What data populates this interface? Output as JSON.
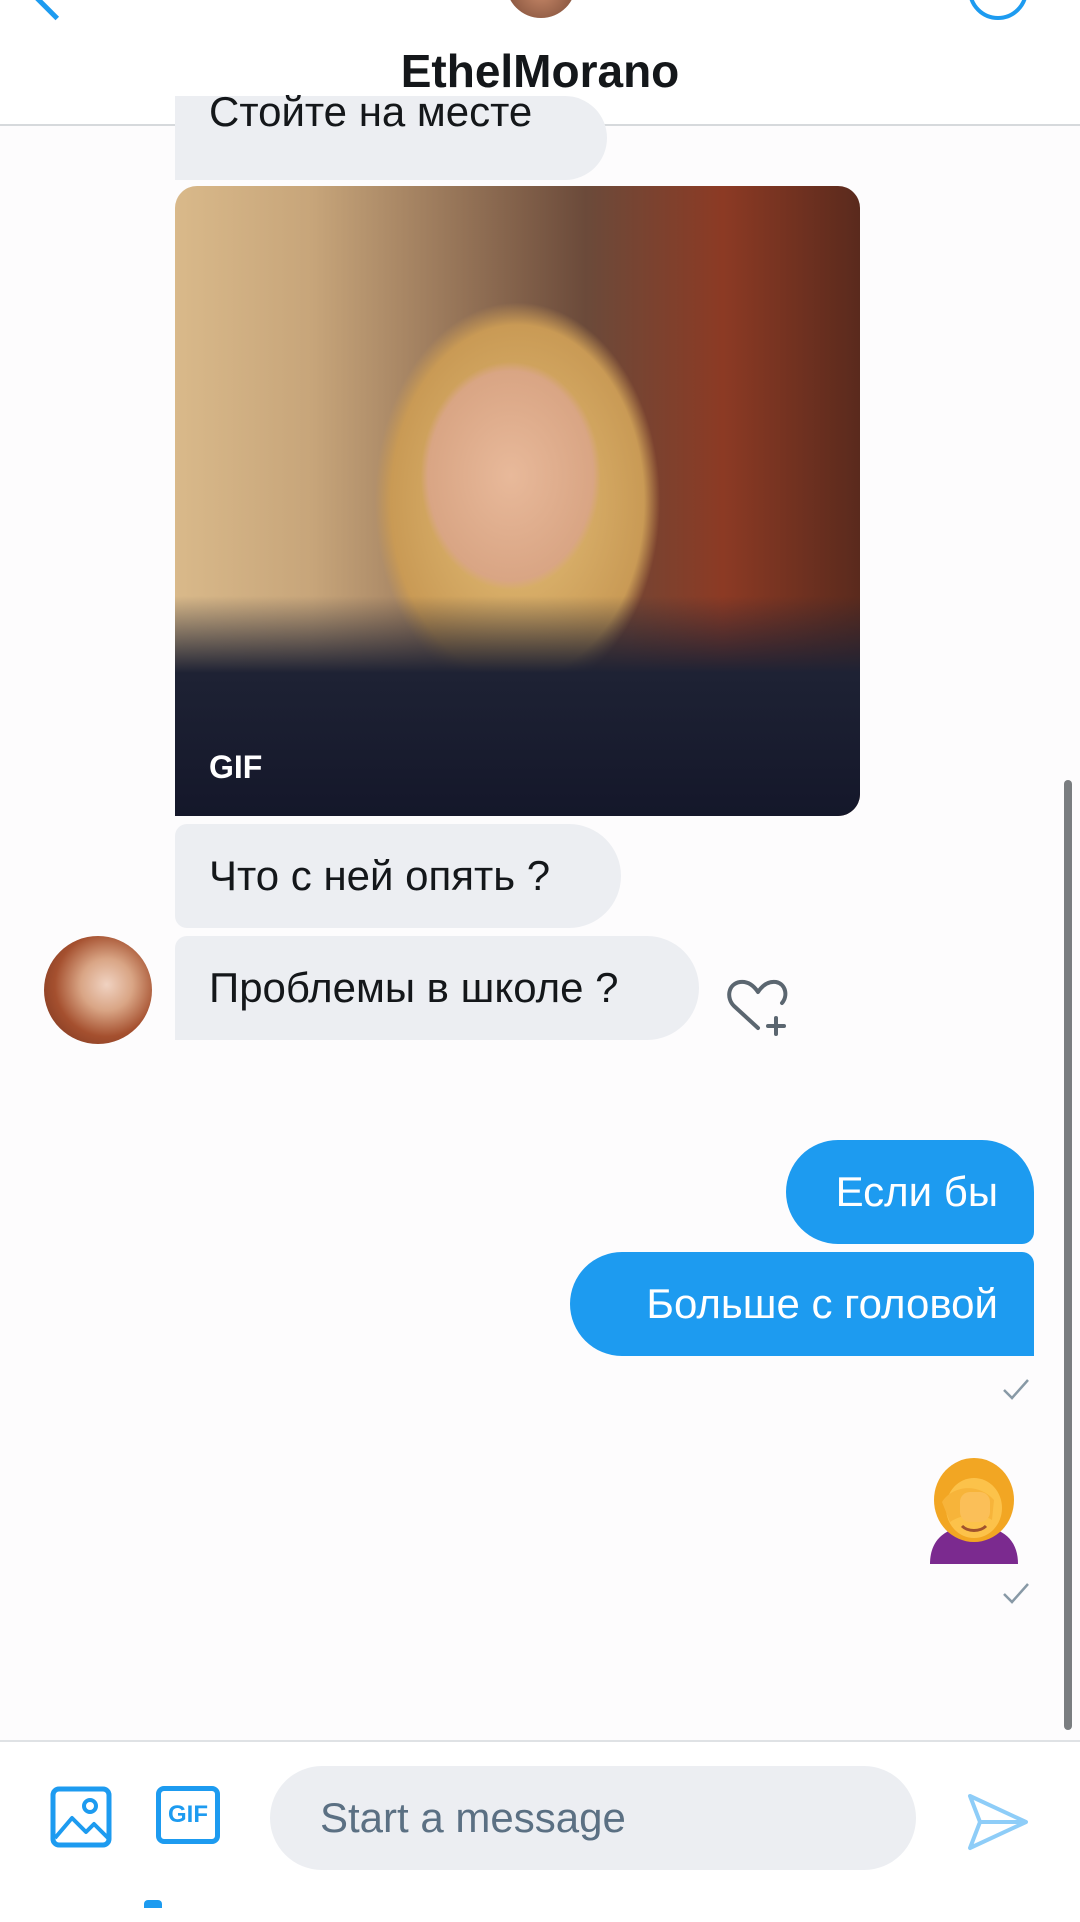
{
  "header": {
    "title": "EthelMorano"
  },
  "conversation": {
    "incoming": [
      {
        "text": "Стойте на месте"
      },
      {
        "media": "gif",
        "badge": "GIF"
      },
      {
        "text": "Что с ней опять ?"
      },
      {
        "text": "Проблемы в школе ?"
      }
    ],
    "outgoing": [
      {
        "text": "Если бы"
      },
      {
        "text": "Больше с головой"
      },
      {
        "emoji": "🤦‍♀️"
      }
    ]
  },
  "composer": {
    "gif_label": "GIF",
    "placeholder": "Start a message"
  },
  "colors": {
    "accent": "#1d9bf0",
    "incoming_bubble": "#eceef2",
    "outgoing_bubble": "#1d9bf0"
  }
}
